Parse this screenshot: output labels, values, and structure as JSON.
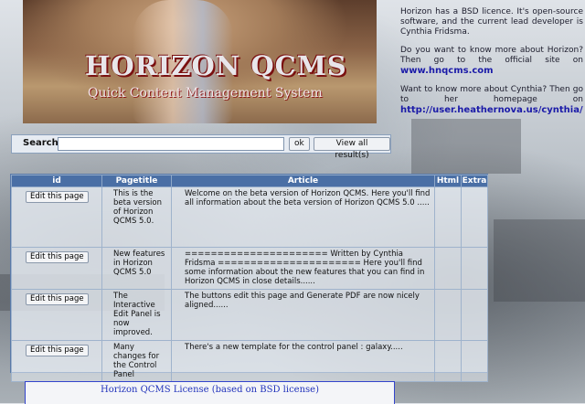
{
  "banner": {
    "title": "HORIZON QCMS",
    "subtitle": "Quick Content Management System"
  },
  "info": {
    "p1": "Horizon has a BSD licence. It's open-source software, and the current lead developer is Cynthia Fridsma.",
    "p2": "Do you want to know more about Horizon? Then go to the official site on",
    "p2_link": "www.hnqcms.com",
    "p3": "Want to know more about Cynthia? Then go to her homepage on",
    "p3_link": "http://user.heathernova.us/cynthia/"
  },
  "search": {
    "label": "Search",
    "value": "",
    "ok_label": "ok",
    "view_all_label": "View all result(s)"
  },
  "table": {
    "headers": [
      "id",
      "Pagetitle",
      "Article",
      "Html",
      "Extra"
    ],
    "edit_label": "Edit this page",
    "rows": [
      {
        "pagetitle": "This is the beta version of Horizon QCMS 5.0.",
        "article": "Welcome on the beta version of Horizon QCMS. Here you'll find all information about the beta version of Horizon QCMS 5.0 .....",
        "html": "",
        "extra": ""
      },
      {
        "pagetitle": "New features in Horizon QCMS 5.0",
        "article": "====================== Written by Cynthia Fridsma ====================== Here you'll find some information about the new features that you can find in Horizon QCMS in close details......",
        "html": "",
        "extra": ""
      },
      {
        "pagetitle": "The Interactive Edit Panel is now improved.",
        "article": "The buttons edit this page and Generate PDF are now nicely aligned......",
        "html": "",
        "extra": ""
      },
      {
        "pagetitle": "Many changes for the Control Panel",
        "article": "There's a new template for the control panel : galaxy.....",
        "html": "",
        "extra": ""
      }
    ]
  },
  "license": {
    "title": "Horizon QCMS License (based on BSD license)"
  }
}
